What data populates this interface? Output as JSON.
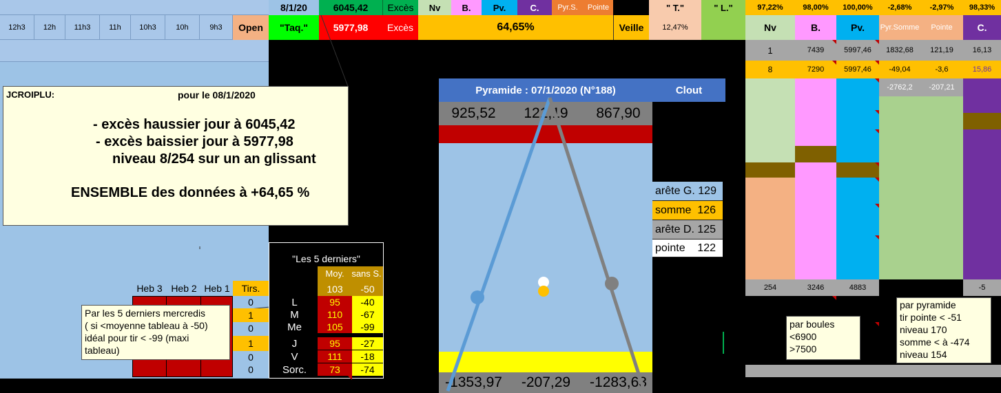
{
  "top_row": {
    "date": "8/1/20",
    "high_value": "6045,42",
    "exces_label": "Excès",
    "nv": "Nv",
    "b": "B.",
    "pv": "Pv.",
    "c": "C.",
    "pyrs": "Pyr.S.",
    "pointe": "Pointe",
    "t_label": "\" T.\"",
    "l_label": "\" L.\"",
    "pcts": [
      "97,22%",
      "98,00%",
      "100,00%",
      "-2,68%",
      "-2,97%",
      "98,33%"
    ]
  },
  "second_row": {
    "hours": [
      "12h3",
      "12h",
      "11h3",
      "11h",
      "10h3",
      "10h",
      "9h3"
    ],
    "open_label": "Open",
    "taq_label": "\"Taq.\"",
    "low_value": "5977,98",
    "exces_label": "Excès",
    "pct": "64,65%",
    "veille_label": "Veille",
    "veille_pct": "12,47%",
    "right_headers": [
      "Nv",
      "B.",
      "Pv.",
      "Pyr.Somme",
      "Pointe",
      "C."
    ]
  },
  "right_table": {
    "row1": [
      "1",
      "7439",
      "5997,46",
      "1832,68",
      "121,19",
      "16,13"
    ],
    "row2": [
      "8",
      "7290",
      "5997,46",
      "-49,04",
      "-3,6",
      "15,86"
    ],
    "row3": [
      "-2762,2",
      "-207,21"
    ],
    "bottom": [
      "254",
      "3246",
      "4883",
      "-5"
    ]
  },
  "comment_main": {
    "author": "JCROIPLU:",
    "date_line": "pour le  08/1/2020",
    "line1": "- excès haussier jour à 6045,42",
    "line2": "- excès baissier jour à 5977,98",
    "line3": "niveau 8/254 sur un an glissant",
    "line4": "ENSEMBLE des données à +64,65 %"
  },
  "pyramid": {
    "title": "Pyramide : 07/1/2020 (N°188)",
    "clout": "Clout",
    "top_values": [
      "925,52",
      "121,19",
      "867,90"
    ],
    "bottom_values": [
      "-1353,97",
      "-207,29",
      "-1283,63"
    ]
  },
  "side_legend": {
    "items": [
      {
        "label": "arête G.",
        "value": "129",
        "color": "#9dc3e6"
      },
      {
        "label": "somme",
        "value": "126",
        "color": "#ffc000"
      },
      {
        "label": "arête D.",
        "value": "125",
        "color": "#a6a6a6"
      },
      {
        "label": "pointe",
        "value": "122",
        "color": "#ffffff"
      }
    ]
  },
  "last5": {
    "title": "\"Les 5 derniers\"",
    "header_moy": "Moy.",
    "header_sans": "sans S.",
    "avg": [
      "103",
      "-50"
    ],
    "rows": [
      {
        "day": "L",
        "moy": "95",
        "sans": "-40"
      },
      {
        "day": "M",
        "moy": "110",
        "sans": "-67"
      },
      {
        "day": "Me",
        "moy": "105",
        "sans": "-99"
      },
      {
        "day": "J",
        "moy": "95",
        "sans": "-27"
      },
      {
        "day": "V",
        "moy": "111",
        "sans": "-18"
      },
      {
        "day": "Sorc.",
        "moy": "73",
        "sans": "-74"
      }
    ]
  },
  "heb": {
    "headers": [
      "Heb 3",
      "Heb 2",
      "Heb 1",
      "Tirs."
    ],
    "tirs": [
      "0",
      "1",
      "0",
      "1",
      "0",
      "0"
    ]
  },
  "comment_mercredis": {
    "line1": "Par les 5 derniers mercredis",
    "line2": "( si <moyenne tableau à -50)",
    "line3": "idéal pour tir < -99 (maxi",
    "line4": "tableau)"
  },
  "comment_boules": {
    "line1": "par boules",
    "line2": "<6900",
    "line3": ">7500"
  },
  "comment_pyramide": {
    "line1": "par pyramide",
    "line2": "tir pointe < -51",
    "line3": "niveau 170",
    "line4": "somme < à -474",
    "line5": "niveau 154"
  }
}
